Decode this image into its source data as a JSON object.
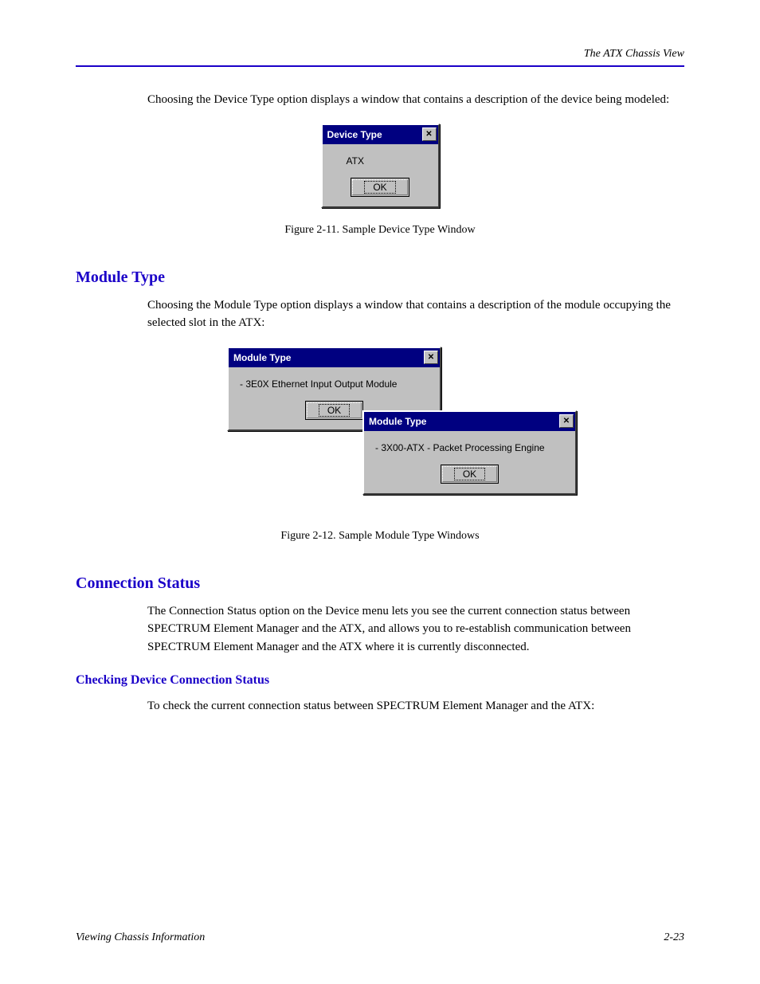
{
  "header": {
    "section_name": "The ATX Chassis View"
  },
  "paragraphs": {
    "p1": "Choosing the Device Type option displays a window that contains a description of the device being modeled:",
    "p2": "Choosing the Module Type option displays a window that contains a description of the module occupying the selected slot in the ATX:",
    "p3": "The Connection Status option on the Device menu lets you see the current connection status between SPECTRUM Element Manager and the ATX, and allows you to re-establish communication between SPECTRUM Element Manager and the ATX where it is currently disconnected.",
    "p4": "To check the current connection status between SPECTRUM Element Manager and the ATX:"
  },
  "captions": {
    "c1": "Figure 2-11. Sample Device Type Window",
    "c2": "Figure 2-12. Sample Module Type Windows"
  },
  "sections": {
    "s1": "Module Type",
    "s2": "Connection Status",
    "s3": "Checking Device Connection Status"
  },
  "dialogs": {
    "device_type": {
      "title": "Device Type",
      "content": "ATX",
      "ok": "OK"
    },
    "module_type_1": {
      "title": "Module Type",
      "content": "- 3E0X Ethernet Input Output Module",
      "ok": "OK"
    },
    "module_type_2": {
      "title": "Module Type",
      "content": "- 3X00-ATX - Packet Processing Engine",
      "ok": "OK"
    }
  },
  "footer": {
    "left": "Viewing Chassis Information",
    "right": "2-23"
  }
}
